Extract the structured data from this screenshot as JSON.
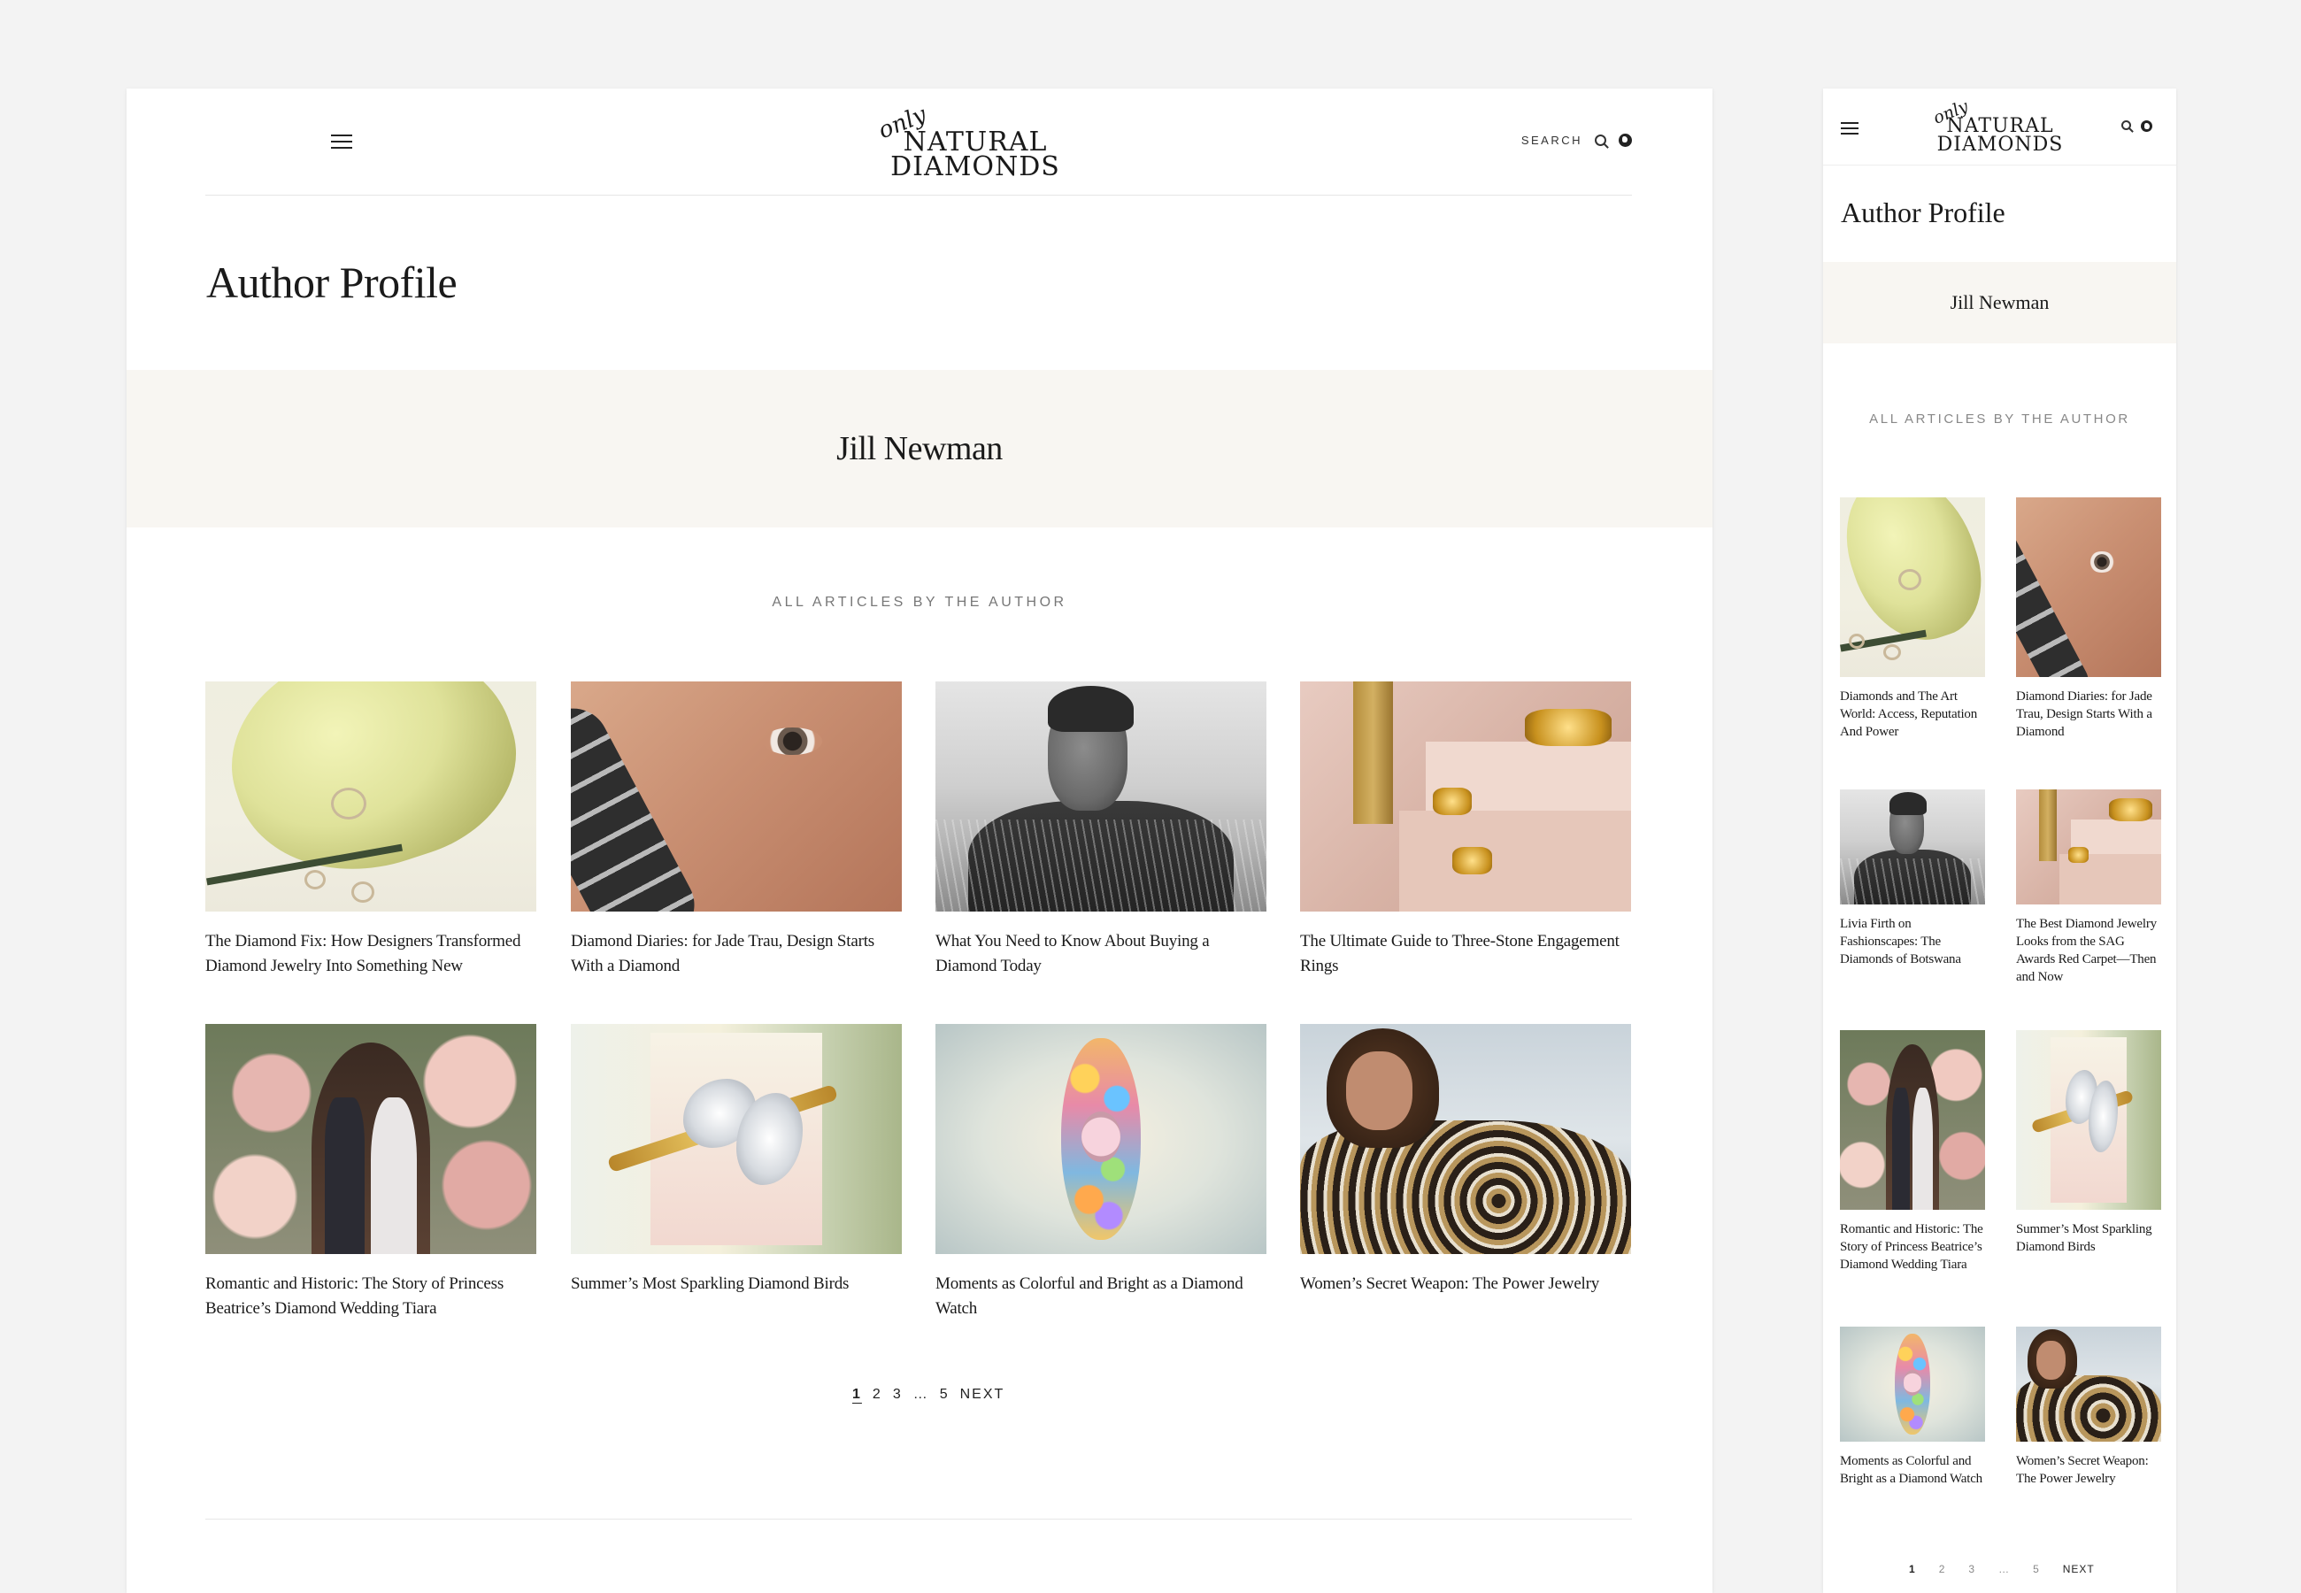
{
  "brand": {
    "logo_small": "only",
    "logo_line1": "NATURAL",
    "logo_line2": "DIAMONDS"
  },
  "header": {
    "search_label": "SEARCH",
    "icons": [
      "hamburger-menu-icon",
      "search-icon",
      "globe-icon"
    ]
  },
  "page": {
    "title": "Author Profile",
    "author_name": "Jill Newman",
    "section_label": "ALL ARTICLES BY THE AUTHOR"
  },
  "desktop_articles": [
    {
      "title": "The Diamond Fix: How Designers Transformed Diamond Jewelry Into Something New"
    },
    {
      "title": "Diamond Diaries: for Jade Trau, Design Starts With a Diamond"
    },
    {
      "title": "What You Need to Know About Buying a Diamond Today"
    },
    {
      "title": "The Ultimate Guide to Three-Stone Engagement Rings"
    },
    {
      "title": "Romantic and Historic: The Story of Princess Beatrice’s Diamond Wedding Tiara"
    },
    {
      "title": "Summer’s Most Sparkling Diamond Birds"
    },
    {
      "title": "Moments as Colorful and Bright as a Diamond Watch"
    },
    {
      "title": "Women’s Secret Weapon: The Power Jewelry"
    }
  ],
  "mobile_articles": [
    {
      "title": "Diamonds and The Art World: Access, Reputation And Power"
    },
    {
      "title": "Diamond Diaries: for Jade Trau, Design Starts With a Diamond"
    },
    {
      "title": "Livia Firth on Fashionscapes: The Diamonds of Botswana"
    },
    {
      "title": "The Best Diamond Jewelry Looks from the SAG Awards Red Carpet—Then and Now"
    },
    {
      "title": "Romantic and Historic: The Story of Princess Beatrice’s Diamond Wedding Tiara"
    },
    {
      "title": "Summer’s Most Sparkling Diamond Birds"
    },
    {
      "title": "Moments as Colorful and Bright as a Diamond Watch"
    },
    {
      "title": "Women’s Secret Weapon: The Power Jewelry"
    }
  ],
  "pagination": {
    "pages": [
      "1",
      "2",
      "3",
      "…",
      "5"
    ],
    "current": "1",
    "next_label": "NEXT"
  },
  "colors": {
    "background": "#f3f3f3",
    "author_band": "#f8f6f2",
    "text": "#1a1a1a",
    "muted": "#777777"
  }
}
